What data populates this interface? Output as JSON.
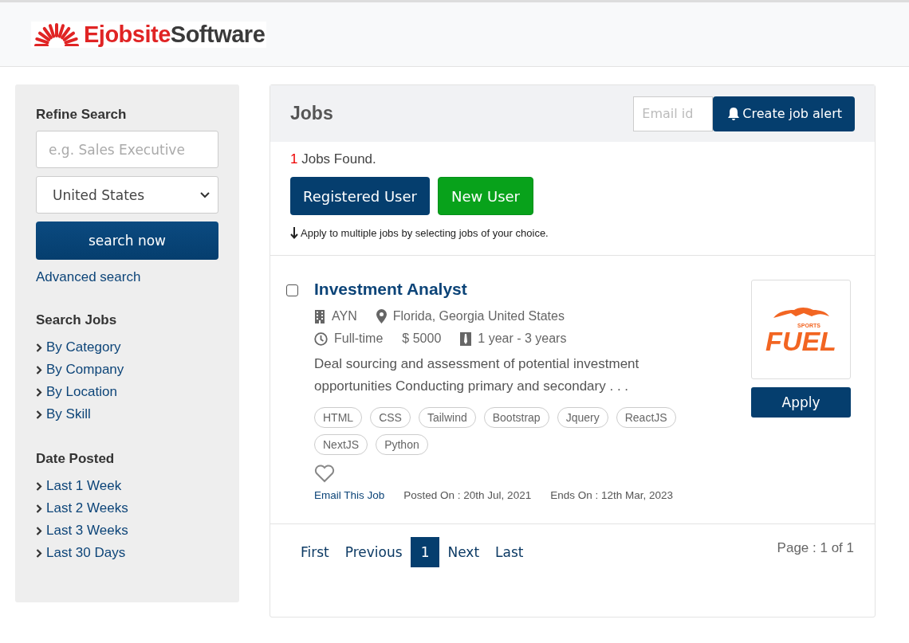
{
  "logo": {
    "parts": [
      "Ejobsite",
      "Software"
    ]
  },
  "sidebar": {
    "refine_title": "Refine Search",
    "keyword": {
      "placeholder": "e.g. Sales Executive"
    },
    "country": {
      "value": "United States"
    },
    "search_button": "search now",
    "advanced_link": "Advanced search",
    "sections": [
      {
        "title": "Search Jobs",
        "items": [
          "By Category",
          "By Company",
          "By Location",
          "By Skill"
        ]
      },
      {
        "title": "Date Posted",
        "items": [
          "Last 1 Week",
          "Last 2 Weeks",
          "Last 3 Weeks",
          "Last 30 Days"
        ]
      }
    ]
  },
  "jobs": {
    "title": "Jobs",
    "email": {
      "placeholder": "Email id"
    },
    "alert_button": "Create job alert",
    "count": "1",
    "found_label": "Jobs Found.",
    "user_buttons": [
      {
        "label": "Registered User",
        "kind": "primary"
      },
      {
        "label": "New User",
        "kind": "success"
      }
    ],
    "hint": "Apply to multiple jobs by selecting jobs of your choice.",
    "listings": [
      {
        "checked": false,
        "title": "Investment Analyst",
        "company": "AYN",
        "location": "Florida, Georgia United States",
        "type": "Full-time",
        "salary": "$ 5000",
        "experience": "1 year - 3 years",
        "description": "Deal sourcing and assessment of potential investment opportunities Conducting primary and secondary . . .",
        "skills": [
          "HTML",
          "CSS",
          "Tailwind",
          "Bootstrap",
          "Jquery",
          "ReactJS",
          "NextJS",
          "Python"
        ],
        "email_link": "Email This Job",
        "posted": "Posted On : 20th Jul, 2021",
        "ends": "Ends On : 12th Mar, 2023",
        "logo_small": "SPORTS",
        "logo_big": "FUEL",
        "apply": "Apply"
      }
    ],
    "pagination": {
      "links": [
        {
          "label": "First",
          "selected": false
        },
        {
          "label": "Previous",
          "selected": false
        },
        {
          "label": "1",
          "selected": true
        },
        {
          "label": "Next",
          "selected": false
        },
        {
          "label": "Last",
          "selected": false
        }
      ],
      "page_info": "Page : 1 of 1"
    }
  }
}
